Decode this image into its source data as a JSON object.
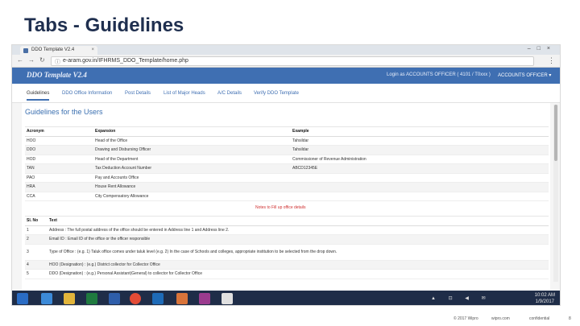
{
  "slide": {
    "title": "Tabs - Guidelines"
  },
  "browser": {
    "tab_title": "DDO Template V2.4",
    "tab_close": "×",
    "url": "e-aram.gov.in/IFHRMS_DDO_Template/home.php",
    "window_controls": "–□×",
    "nav": {
      "back": "←",
      "forward": "→",
      "reload": "↻"
    },
    "lock": "ⓘ",
    "menu": "⋮"
  },
  "app": {
    "name": "DDO Template V2.4",
    "login_text": "Login as ACCOUNTS OFFICER ( 4101 / T0xxx )",
    "user_menu": "ACCOUNTS OFFICER ▾",
    "tabs": [
      "Guidelines",
      "DDO Office Information",
      "Post Details",
      "List of Major Heads",
      "A/C Details",
      "Verify DDO Template"
    ],
    "content_title": "Guidelines for the Users"
  },
  "acronym_table": {
    "headers": [
      "Acronym",
      "Expansion",
      "Example"
    ],
    "rows": [
      [
        "HOO",
        "Head of the Office",
        "Tahsildar"
      ],
      [
        "DDO",
        "Drawing and Disbursing Officer",
        "Tahsildar"
      ],
      [
        "HOD",
        "Head of the Department",
        "Commissioner of Revenue Administration"
      ],
      [
        "TAN",
        "Tax Deduction Account Number",
        "ABCD12345E"
      ],
      [
        "PAO",
        "Pay and Accounts Office",
        ""
      ],
      [
        "HRA",
        "House Rent Allowance",
        ""
      ],
      [
        "CCA",
        "City Compensatory Allowance",
        ""
      ]
    ]
  },
  "notes_link": "Notes to Fill up office details",
  "notes_table": {
    "headers": [
      "Sl. No",
      "Text"
    ],
    "rows": [
      [
        "1",
        "Address : The full postal address of the office should be entered in Address line 1 and Address line 2."
      ],
      [
        "2",
        "Email ID : Email ID of the office or the officer responsible"
      ],
      [
        "3",
        "Type of Office : (e.g. 1) Taluk office comes under taluk level (e.g. 2) In the case of Schools and colleges, appropriate institution to be selected from the drop down."
      ],
      [
        "4",
        "HOO (Designation) : (e.g.) District collector for Collector Office"
      ],
      [
        "5",
        "DDO (Designation) : (e.g.) Personal Assistant(General) to collector for Collector Office"
      ]
    ]
  },
  "taskbar": {
    "time": "10:02 AM",
    "date": "1/9/2017",
    "tray": "▲ ⊡ ◀ ✉"
  },
  "footer": {
    "copyright": "© 2017 Wipro",
    "site": "wipro.com",
    "confidential": "confidential",
    "page": "8"
  },
  "colors": {
    "app_header": "#3f6fb2",
    "slide_title": "#1f2f4f",
    "taskbar": "#1f2d48"
  }
}
